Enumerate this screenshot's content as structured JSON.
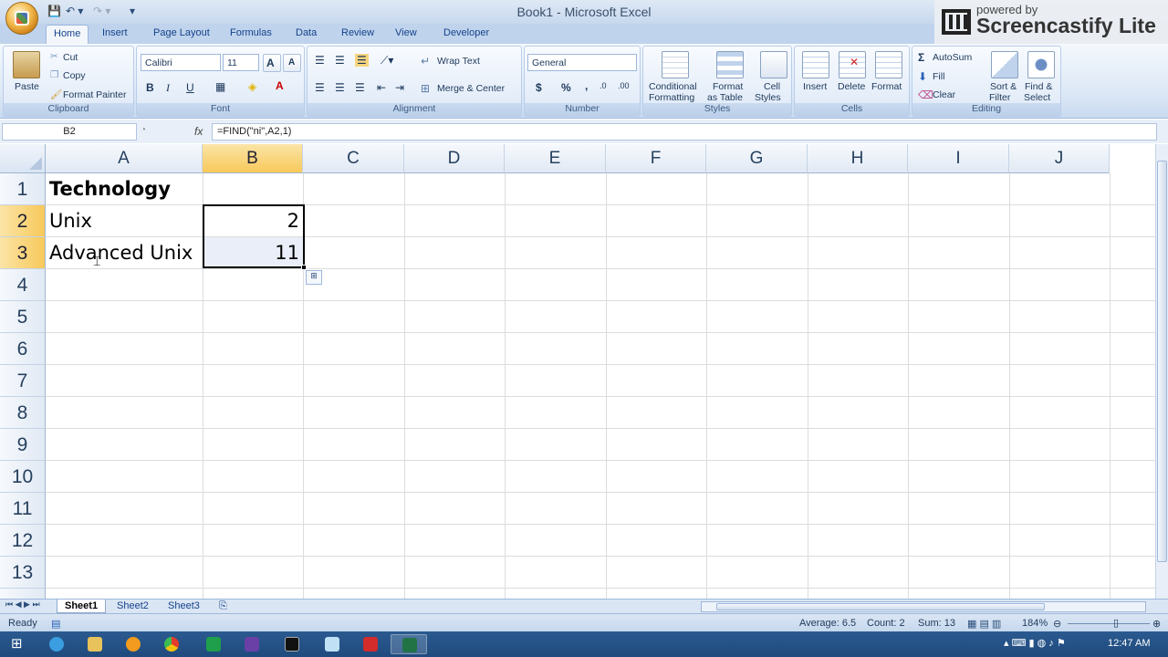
{
  "window": {
    "title": "Book1 - Microsoft Excel"
  },
  "qat": {
    "save": "💾",
    "undo": "↶ ▾",
    "redo": "↷ ▾",
    "customize": "▾"
  },
  "screencastify": {
    "powered": "powered by",
    "name": "Screencastify Lite"
  },
  "tabs": [
    "Home",
    "Insert",
    "Page Layout",
    "Formulas",
    "Data",
    "Review",
    "View",
    "Developer"
  ],
  "ribbon": {
    "clipboard": {
      "label": "Clipboard",
      "paste": "Paste",
      "cut": "Cut",
      "copy": "Copy",
      "format_painter": "Format Painter"
    },
    "font": {
      "label": "Font",
      "name": "Calibri",
      "size": "11",
      "bold": "B",
      "italic": "I",
      "underline": "U"
    },
    "alignment": {
      "label": "Alignment",
      "wrap": "Wrap Text",
      "merge": "Merge & Center"
    },
    "number": {
      "label": "Number",
      "format": "General",
      "currency": "$",
      "percent": "%",
      "comma": ","
    },
    "styles": {
      "label": "Styles",
      "conditional": "Conditional",
      "conditional2": "Formatting",
      "format_table": "Format",
      "format_table2": "as Table",
      "cell_styles": "Cell",
      "cell_styles2": "Styles"
    },
    "cells": {
      "label": "Cells",
      "insert": "Insert",
      "delete": "Delete",
      "format": "Format"
    },
    "editing": {
      "label": "Editing",
      "autosum": "AutoSum",
      "fill": "Fill",
      "clear": "Clear",
      "sort": "Sort &",
      "sort2": "Filter",
      "find": "Find &",
      "find2": "Select"
    }
  },
  "formula_bar": {
    "name_box": "B2",
    "fx": "fx",
    "formula": "=FIND(\"ni\",A2,1)"
  },
  "grid": {
    "columns": [
      "A",
      "B",
      "C",
      "D",
      "E",
      "F",
      "G",
      "H",
      "I",
      "J"
    ],
    "rows": [
      "1",
      "2",
      "3",
      "4",
      "5",
      "6",
      "7",
      "8",
      "9",
      "10",
      "11",
      "12",
      "13"
    ],
    "cells": {
      "A1": "Technology",
      "A2": "Unix",
      "A3": "Advanced Unix",
      "B2": "2",
      "B3": "11"
    }
  },
  "sheets": [
    "Sheet1",
    "Sheet2",
    "Sheet3"
  ],
  "status": {
    "ready": "Ready",
    "average": "Average: 6.5",
    "count": "Count: 2",
    "sum": "Sum: 13",
    "zoom": "184%"
  },
  "taskbar": {
    "time": "12:47 AM"
  }
}
